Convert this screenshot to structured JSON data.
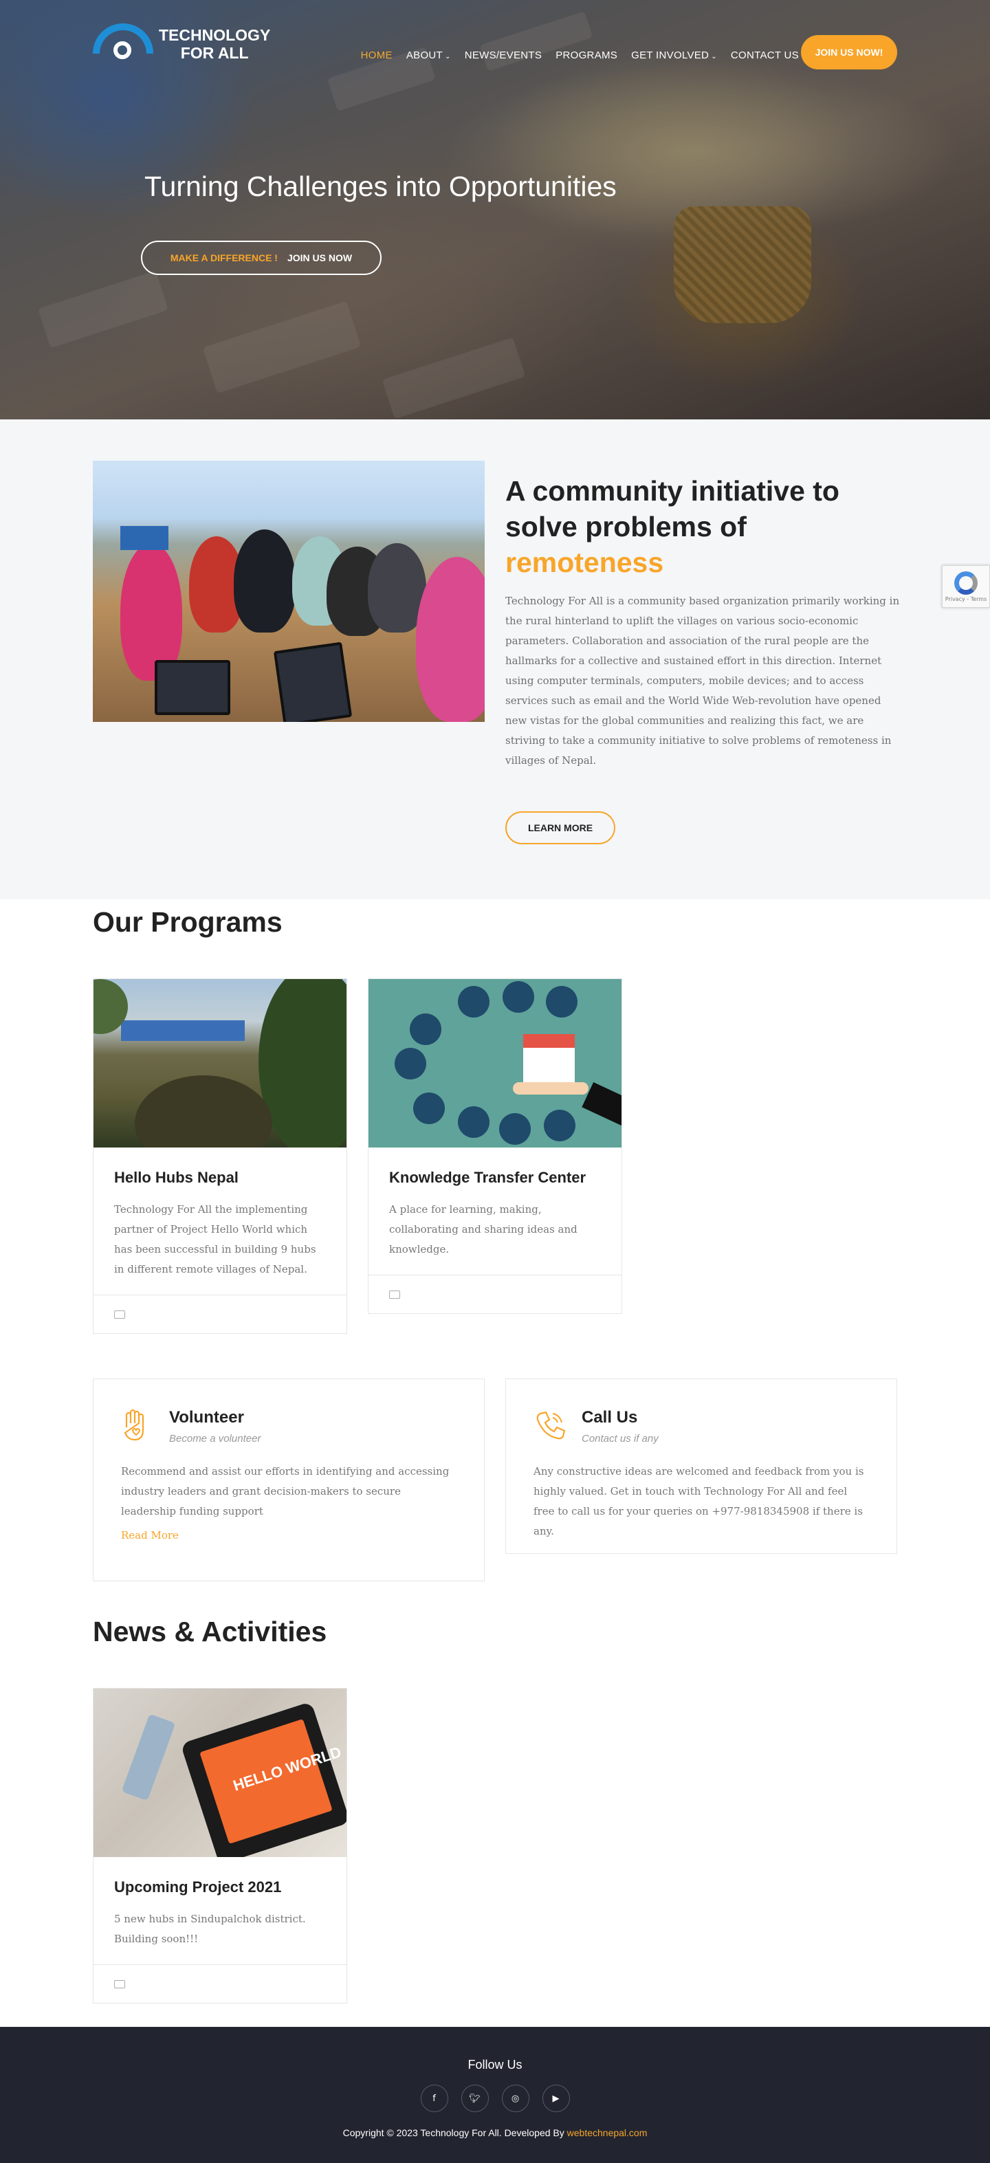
{
  "header": {
    "logo_line1": "TECHNOLOGY",
    "logo_line2": "FOR ALL",
    "nav": [
      {
        "label": "HOME",
        "active": true,
        "dropdown": false
      },
      {
        "label": "ABOUT",
        "active": false,
        "dropdown": true
      },
      {
        "label": "NEWS/EVENTS",
        "active": false,
        "dropdown": false
      },
      {
        "label": "PROGRAMS",
        "active": false,
        "dropdown": false
      },
      {
        "label": "GET INVOLVED",
        "active": false,
        "dropdown": true
      },
      {
        "label": "CONTACT US",
        "active": false,
        "dropdown": false
      }
    ],
    "join_button": "JOIN US NOW!"
  },
  "hero": {
    "title": "Turning Challenges into Opportunities",
    "cta_primary": "MAKE A DIFFERENCE !",
    "cta_secondary": "JOIN US NOW"
  },
  "about": {
    "heading_line": "A community initiative to solve problems of",
    "heading_highlight": "remoteness",
    "body": "Technology For All is a community based organization primarily working in the rural hinterland to uplift the villages on various socio-economic parameters. Collaboration and association of the rural people are the hallmarks for a collective and sustained effort in this direction.  Internet using computer terminals, computers, mobile devices; and to access services such as email and the World Wide Web-revolution have opened new vistas for the global communities and realizing this fact, we are striving to take a community initiative to solve problems of remoteness in villages of Nepal.",
    "learn_more": "LEARN MORE"
  },
  "recaptcha": {
    "text": "Privacy - Terms"
  },
  "programs": {
    "title": "Our Programs",
    "items": [
      {
        "title": "Hello Hubs Nepal",
        "desc": "Technology For All the implementing partner of Project Hello World which has been successful in building 9 hubs in different remote villages of Nepal."
      },
      {
        "title": "Knowledge Transfer Center",
        "desc": "A place for learning, making, collaborating and sharing ideas and knowledge."
      }
    ]
  },
  "involve": {
    "volunteer": {
      "title": "Volunteer",
      "subtitle": "Become a volunteer",
      "text": "Recommend and assist our efforts in identifying and accessing industry leaders and grant decision-makers to secure leadership funding support",
      "link": "Read More"
    },
    "call": {
      "title": "Call Us",
      "subtitle": "Contact us if any",
      "text": "Any constructive ideas are welcomed and feedback from you is highly valued. Get in touch with Technology For All and feel free to call us for your queries on +977-9818345908 if there is any."
    }
  },
  "news": {
    "title": "News & Activities",
    "items": [
      {
        "title": "Upcoming Project 2021",
        "desc": "5 new hubs in Sindupalchok district. Building soon!!!",
        "image_text": "HELLO WORLD"
      }
    ]
  },
  "footer": {
    "follow": "Follow Us",
    "socials": [
      "f",
      "t",
      "ig",
      "yt"
    ],
    "copyright": "Copyright © 2023 Technology For All. Developed By ",
    "developer": "webtechnepal.com"
  },
  "colors": {
    "accent": "#f8a52a",
    "dark": "#222530",
    "brand_blue": "#1e8fd6"
  }
}
